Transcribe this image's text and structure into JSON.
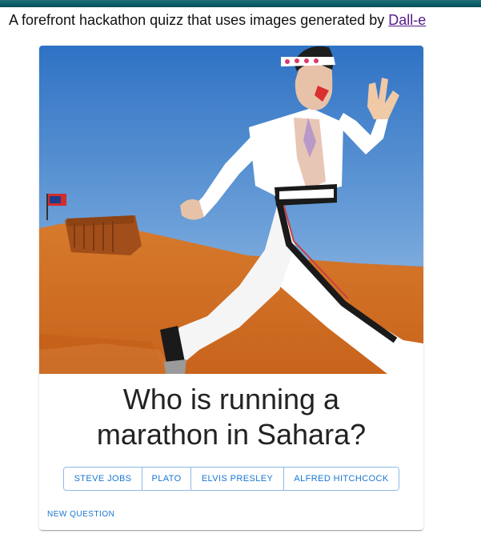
{
  "header": {
    "intro_text": "A forefront hackathon quizz that uses images generated by ",
    "link_text": "Dall-e",
    "bar_color": "#0b5f68"
  },
  "quiz": {
    "image_alt": "Man in a white jumpsuit running in a desert",
    "question_line1": "Who is running a",
    "question_line2": "marathon in Sahara?",
    "answers": [
      {
        "label": "STEVE JOBS"
      },
      {
        "label": "PLATO"
      },
      {
        "label": "ELVIS PRESLEY"
      },
      {
        "label": "ALFRED HITCHCOCK"
      }
    ],
    "new_question_label": "NEW QUESTION",
    "accent_color": "#1976d2"
  }
}
